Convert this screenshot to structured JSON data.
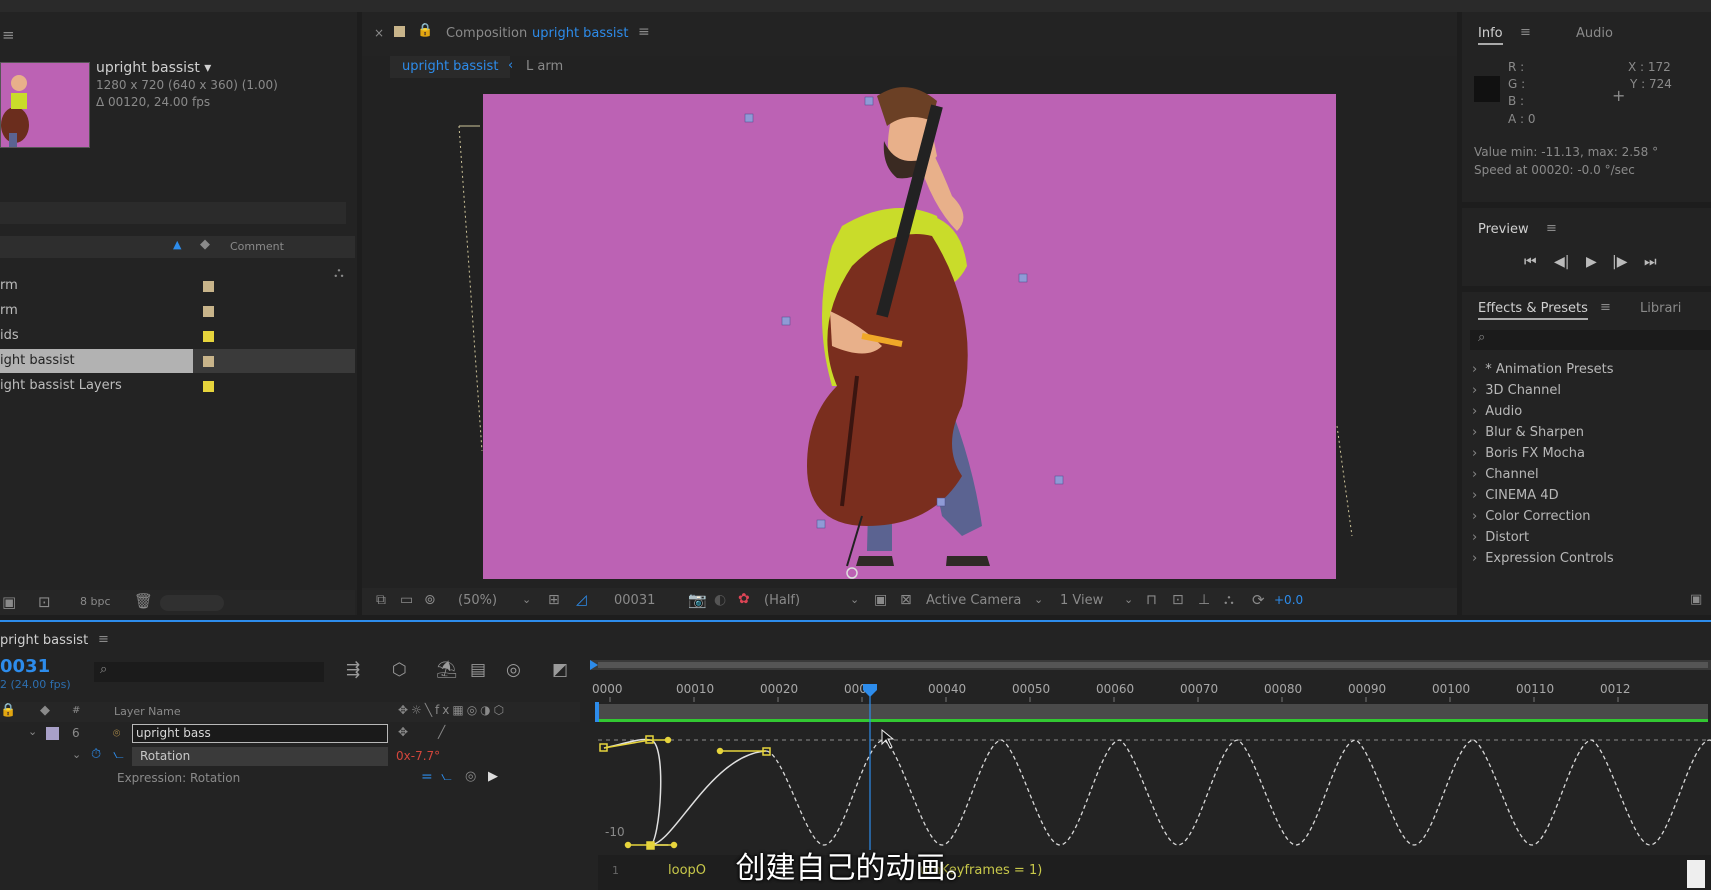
{
  "project": {
    "item_name": "upright bassist ▾",
    "item_size": "1280 x 720  (640 x 360) (1.00)",
    "item_duration": "Δ 00120, 24.00 fps",
    "column_comment": "Comment",
    "rows": [
      {
        "label": "rm",
        "color": "#c8b48a",
        "selected": false
      },
      {
        "label": "rm",
        "color": "#c8b48a",
        "selected": false
      },
      {
        "label": "ids",
        "color": "#e6d43c",
        "selected": false
      },
      {
        "label": "ight bassist",
        "color": "#c8b48a",
        "selected": true
      },
      {
        "label": "ight bassist Layers",
        "color": "#e6d43c",
        "selected": false
      }
    ],
    "bpc": "8 bpc"
  },
  "composition": {
    "title_prefix": "Composition",
    "title_name": "upright bassist",
    "crumb_active": "upright bassist",
    "crumb_next": "L arm",
    "canvas_color": "#bc62b4",
    "zoom": "(50%)",
    "timecode": "00031",
    "resolution": "(Half)",
    "camera": "Active Camera",
    "views": "1 View",
    "exposure": "+0.0"
  },
  "info": {
    "tab_info": "Info",
    "tab_audio": "Audio",
    "r": "R :",
    "g": "G :",
    "b": "B :",
    "a": "A :  0",
    "x": "X : 172",
    "y": "Y : 724",
    "value_line": "Value min: -11.13, max: 2.58 °",
    "speed_line": "Speed at 00020: -0.0 °/sec"
  },
  "preview": {
    "title": "Preview"
  },
  "effects": {
    "tab": "Effects & Presets",
    "tab2": "Librari",
    "items": [
      "* Animation Presets",
      "3D Channel",
      "Audio",
      "Blur & Sharpen",
      "Boris FX Mocha",
      "Channel",
      "CINEMA 4D",
      "Color Correction",
      "Distort",
      "Expression Controls"
    ]
  },
  "timeline": {
    "comp_tab": "pright bassist",
    "current_time": "0031",
    "fps": "2 (24.00 fps)",
    "col_layer_name": "Layer Name",
    "layer_index": "6",
    "layer_name": "upright bass",
    "property": "Rotation",
    "property_value": "0x-7.7°",
    "expression_label": "Expression: Rotation",
    "graph_label": "-10",
    "ruler": [
      "0000",
      "00010",
      "00020",
      "000",
      "00040",
      "00050",
      "00060",
      "00070",
      "00080",
      "00090",
      "00100",
      "00110",
      "0012"
    ],
    "code_line_no": "1",
    "code_start": "loopO",
    "code_end": "umKeyframes = 1)"
  },
  "subtitle": "创建自己的动画。"
}
